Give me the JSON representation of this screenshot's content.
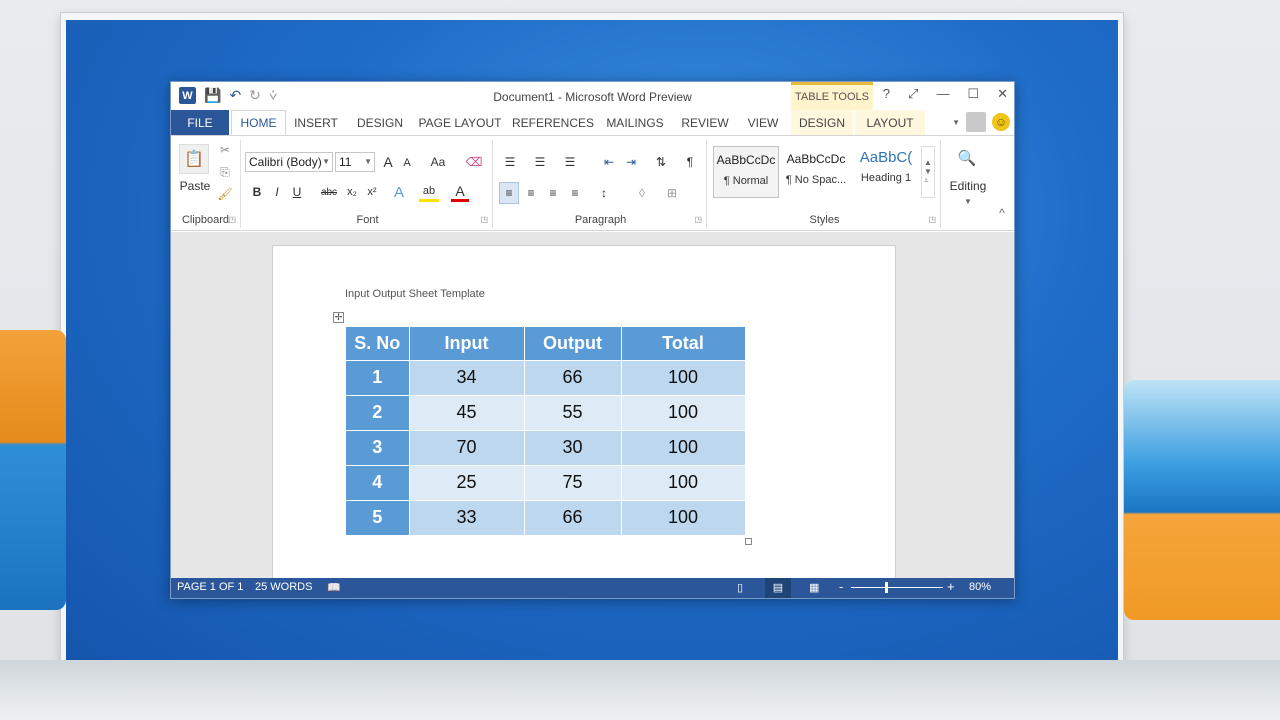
{
  "window": {
    "title": "Document1 - Microsoft Word Preview",
    "contextual_group": "TABLE TOOLS",
    "help": "?",
    "restore": "⤢",
    "minimize": "—",
    "maximize": "☐",
    "close": "✕"
  },
  "qat": {
    "app_icon": "W",
    "save": "💾",
    "undo": "↶",
    "redo": "↻",
    "customize": "⩒"
  },
  "tabs": {
    "file": "FILE",
    "home": "HOME",
    "insert": "INSERT",
    "design": "DESIGN",
    "page_layout": "PAGE LAYOUT",
    "references": "REFERENCES",
    "mailings": "MAILINGS",
    "review": "REVIEW",
    "view": "VIEW",
    "tt_design": "DESIGN",
    "tt_layout": "LAYOUT"
  },
  "ribbon": {
    "clipboard": {
      "label": "Clipboard",
      "paste": "Paste",
      "cut": "✂",
      "copy": "⎘",
      "format_painter": "🖌"
    },
    "font": {
      "label": "Font",
      "name": "Calibri (Body)",
      "size": "11",
      "grow": "A",
      "shrink": "A",
      "case": "Aa",
      "clear": "⌫",
      "bold": "B",
      "italic": "I",
      "underline": "U",
      "strike": "abc",
      "sub": "x₂",
      "sup": "x²",
      "effects": "A",
      "highlight": "ab",
      "color": "A"
    },
    "paragraph": {
      "label": "Paragraph",
      "bullets": "☰",
      "numbering": "☰",
      "multilevel": "☰",
      "decrease_indent": "⇤",
      "increase_indent": "⇥",
      "sort": "⇅",
      "pilcrow": "¶",
      "align_left": "≡",
      "center": "≡",
      "align_right": "≡",
      "justify": "≡",
      "line_spacing": "↕",
      "shading": "◊",
      "borders": "⊞"
    },
    "styles": {
      "label": "Styles",
      "items": [
        {
          "sample": "AaBbCcDc",
          "name": "¶ Normal"
        },
        {
          "sample": "AaBbCcDc",
          "name": "¶ No Spac..."
        },
        {
          "sample": "AaBbC(",
          "name": "Heading 1"
        }
      ]
    },
    "editing": {
      "label": "Editing",
      "icon": "🔍"
    },
    "collapse": "^"
  },
  "document": {
    "heading": "Input Output Sheet Template",
    "table": {
      "headers": [
        "S. No",
        "Input",
        "Output",
        "Total"
      ],
      "rows": [
        [
          "1",
          "34",
          "66",
          "100"
        ],
        [
          "2",
          "45",
          "55",
          "100"
        ],
        [
          "3",
          "70",
          "30",
          "100"
        ],
        [
          "4",
          "25",
          "75",
          "100"
        ],
        [
          "5",
          "33",
          "66",
          "100"
        ]
      ]
    }
  },
  "status": {
    "page": "PAGE 1 OF 1",
    "words": "25 WORDS",
    "proofing": "📖",
    "read_mode": "▯",
    "print_layout": "▤",
    "web_layout": "▦",
    "zoom_out": "-",
    "zoom_in": "+",
    "zoom": "80%"
  },
  "colors": {
    "accent": "#2b579a",
    "table_header": "#5b9bd5",
    "table_band_dark": "#bdd7ee",
    "table_band_light": "#deebf7",
    "contextual_tab": "#e8b93b"
  }
}
